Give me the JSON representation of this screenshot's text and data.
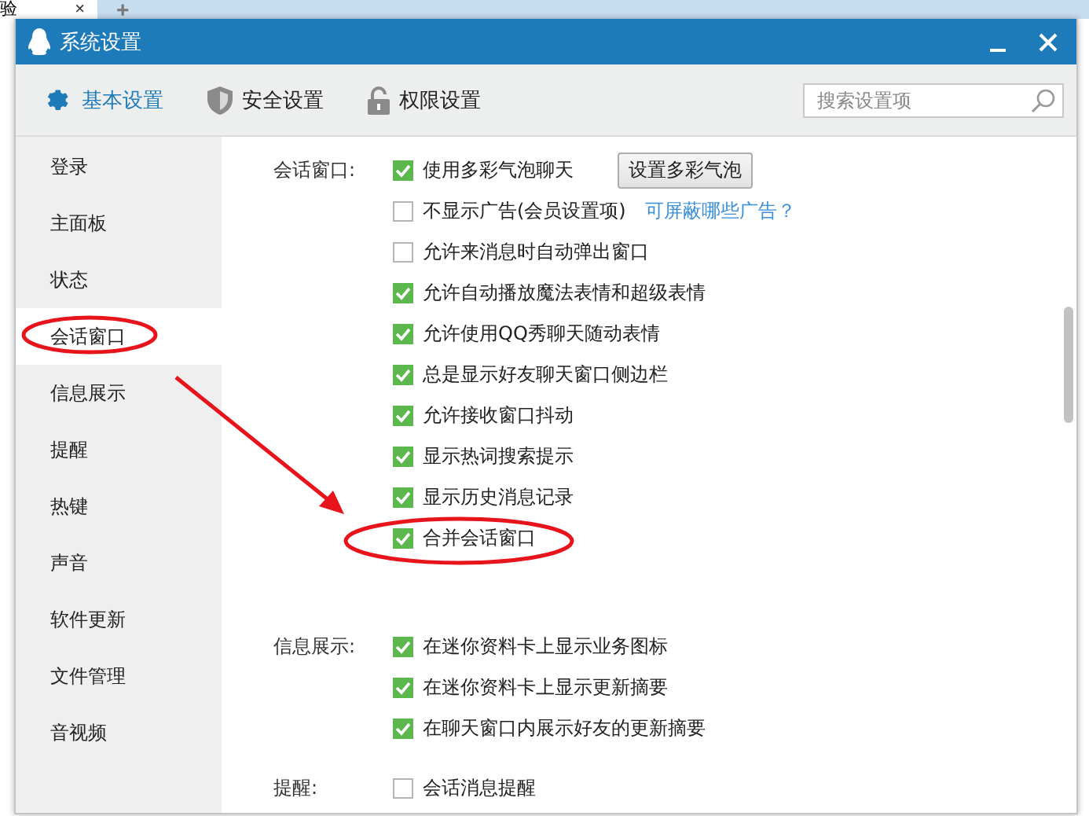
{
  "browser_tab": {
    "label": "验",
    "close": "×",
    "new_tab": "+"
  },
  "window": {
    "title": "系统设置"
  },
  "tabs": [
    {
      "label": "基本设置",
      "selected": true,
      "kind": "gear"
    },
    {
      "label": "安全设置",
      "selected": false,
      "kind": "shield"
    },
    {
      "label": "权限设置",
      "selected": false,
      "kind": "lock"
    }
  ],
  "search": {
    "placeholder": "搜索设置项"
  },
  "sidebar": {
    "items": [
      {
        "label": "登录",
        "selected": false
      },
      {
        "label": "主面板",
        "selected": false
      },
      {
        "label": "状态",
        "selected": false
      },
      {
        "label": "会话窗口",
        "selected": true
      },
      {
        "label": "信息展示",
        "selected": false
      },
      {
        "label": "提醒",
        "selected": false
      },
      {
        "label": "热键",
        "selected": false
      },
      {
        "label": "声音",
        "selected": false
      },
      {
        "label": "软件更新",
        "selected": false
      },
      {
        "label": "文件管理",
        "selected": false
      },
      {
        "label": "音视频",
        "selected": false
      }
    ]
  },
  "sections": [
    {
      "label": "会话窗口:",
      "options": [
        {
          "label": "使用多彩气泡聊天",
          "checked": true,
          "button": "设置多彩气泡"
        },
        {
          "label": "不显示广告(会员设置项)",
          "checked": false,
          "link": "可屏蔽哪些广告？"
        },
        {
          "label": "允许来消息时自动弹出窗口",
          "checked": false
        },
        {
          "label": "允许自动播放魔法表情和超级表情",
          "checked": true
        },
        {
          "label": "允许使用QQ秀聊天随动表情",
          "checked": true
        },
        {
          "label": "总是显示好友聊天窗口侧边栏",
          "checked": true
        },
        {
          "label": "允许接收窗口抖动",
          "checked": true
        },
        {
          "label": "显示热词搜索提示",
          "checked": true
        },
        {
          "label": "显示历史消息记录",
          "checked": true
        },
        {
          "label": "合并会话窗口",
          "checked": true
        }
      ]
    },
    {
      "label": "信息展示:",
      "options": [
        {
          "label": "在迷你资料卡上显示业务图标",
          "checked": true
        },
        {
          "label": "在迷你资料卡上显示更新摘要",
          "checked": true
        },
        {
          "label": "在聊天窗口内展示好友的更新摘要",
          "checked": true
        }
      ]
    },
    {
      "label": "提醒:",
      "options": [
        {
          "label": "会话消息提醒",
          "checked": false
        }
      ]
    }
  ]
}
